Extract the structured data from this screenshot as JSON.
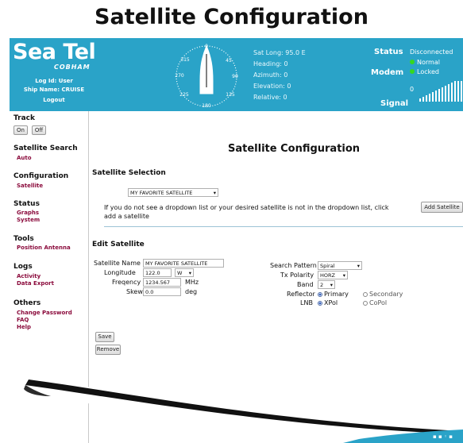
{
  "heading": "Satellite Configuration",
  "brand": {
    "logo": "Sea Tel",
    "sub": "COBHAM"
  },
  "user": {
    "log_id": "Log Id: User",
    "ship_name": "Ship Name: CRUISE",
    "logout": "Logout"
  },
  "compass": {
    "labels": [
      "315",
      "0",
      "45",
      "270",
      "90",
      "225",
      "180",
      "135"
    ]
  },
  "readouts": {
    "sat_long": "Sat Long: 95.0 E",
    "heading": "Heading: 0",
    "azimuth": "Azimuth: 0",
    "elevation": "Elevation: 0",
    "relative": "Relative: 0"
  },
  "status": {
    "status_label": "Status",
    "status_value": "Disconnected",
    "status_normal": "Normal",
    "modem_label": "Modem",
    "modem_value": "Locked",
    "signal_label": "Signal",
    "signal_value": "0"
  },
  "sidebar": {
    "track": "Track",
    "on": "On",
    "off": "Off",
    "satellite_search": "Satellite Search",
    "auto": "Auto",
    "configuration": "Configuration",
    "satellite": "Satellite",
    "status": "Status",
    "graphs": "Graphs",
    "system": "System",
    "tools": "Tools",
    "position_antenna": "Position Antenna",
    "logs": "Logs",
    "activity": "Activity",
    "data_export": "Data Export",
    "others": "Others",
    "change_password": "Change Password",
    "faq": "FAQ",
    "help": "Help"
  },
  "main": {
    "title": "Satellite Configuration",
    "selection_heading": "Satellite Selection",
    "selected_satellite": "MY FAVORITE SATELLITE",
    "hint_line1": "If you do not see a dropdown list or your desired satellite is not in the dropdown list, click",
    "hint_line2": "add a satellite",
    "add_satellite": "Add Satellite",
    "edit_heading": "Edit Satellite",
    "satellite_name_label": "Satellite Name",
    "satellite_name_value": "MY FAVORITE SATELLITE",
    "longitude_label": "Longitude",
    "longitude_value": "122.0",
    "longitude_dir": "W",
    "frequency_label": "Freqency",
    "frequency_value": "1234.567",
    "frequency_unit": "MHz",
    "skew_label": "Skew",
    "skew_value": "0.0",
    "skew_unit": "deg",
    "search_pattern_label": "Search Pattern",
    "search_pattern_value": "Spiral",
    "tx_polarity_label": "Tx Polarity",
    "tx_polarity_value": "HORZ",
    "band_label": "Band",
    "band_value": "2",
    "reflector_label": "Reflector",
    "reflector_primary": "Primary",
    "reflector_secondary": "Secondary",
    "lnb_label": "LNB",
    "lnb_xpol": "XPol",
    "lnb_copol": "CoPol",
    "save": "Save",
    "remove": "Remove"
  },
  "colors": {
    "topbar": "#2aa3c8",
    "link": "#8b0b3c",
    "indicator": "#35d81f"
  }
}
